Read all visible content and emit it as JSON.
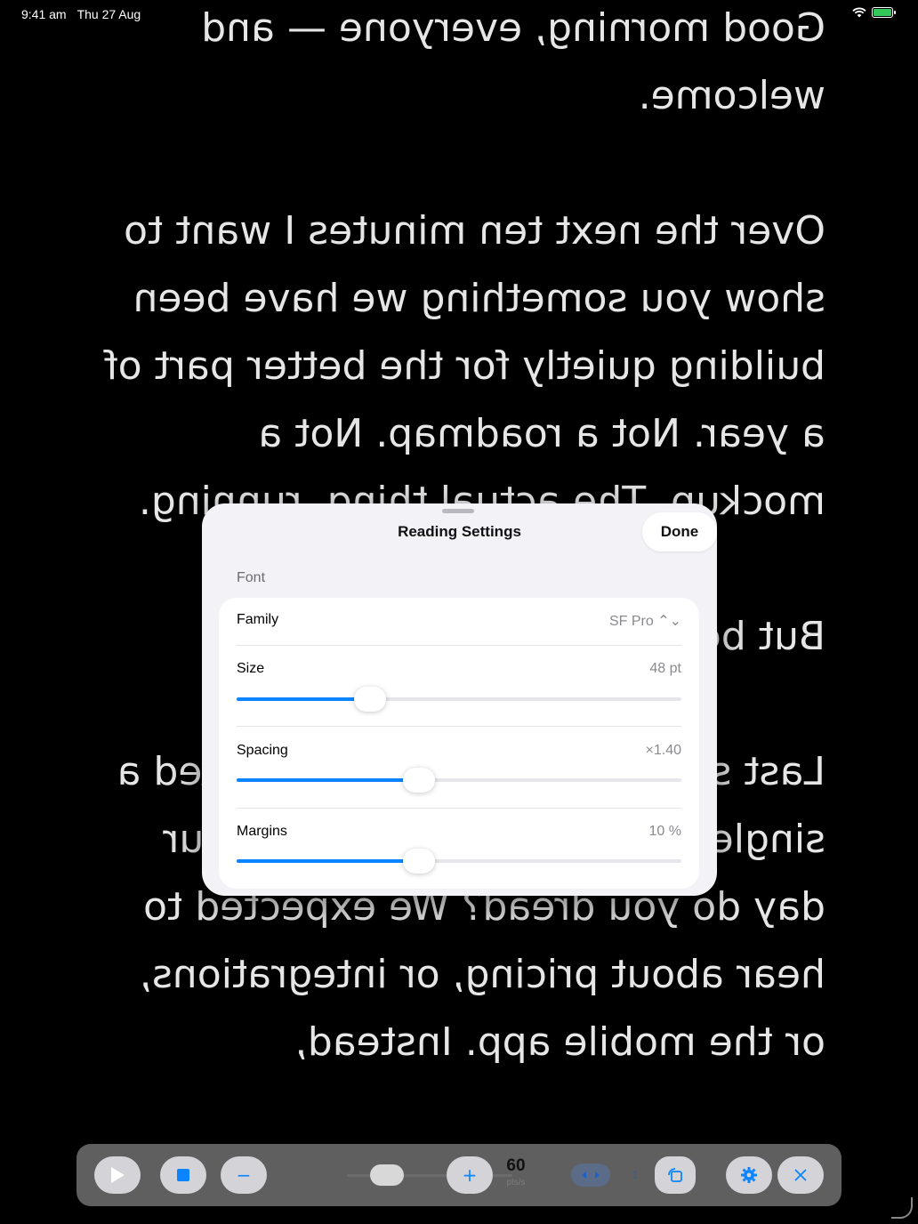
{
  "status_bar": {
    "time": "9:41 am",
    "date": "Thu 27 Aug",
    "battery_color": "#34c759"
  },
  "script_text": [
    "Good morning, everyone — and welcome.",
    "Over the next ten minutes I want to show you something we have been building quietly for the better part of a year. Not a roadmap. Not a mockup. The actual thing, running.",
    "But be why we sta",
    "Last s of our customers and asked a single question: what part of your day do you dread? We expected to hear about pricing, or integrations, or the mobile app. Instead,"
  ],
  "sheet": {
    "title": "Reading Settings",
    "done_label": "Done",
    "section_font": "Font",
    "family": {
      "label": "Family",
      "value": "SF Pro ⌃⌄"
    },
    "size": {
      "label": "Size",
      "value": "48 pt",
      "level": 0.3
    },
    "spacing": {
      "label": "Spacing",
      "value": "×1.40",
      "level": 0.41
    },
    "margins": {
      "label": "Margins",
      "value": "10 %",
      "level": 0.41
    },
    "accent_color": "#0a84ff"
  },
  "toolbar": {
    "play_icon": "play-icon",
    "stop_icon": "stop-icon",
    "minus_label": "−",
    "plus_label": "+",
    "speed_value": "60",
    "speed_unit": "pts/s",
    "settings_icon": "gear-icon",
    "close_icon": "close-icon"
  }
}
